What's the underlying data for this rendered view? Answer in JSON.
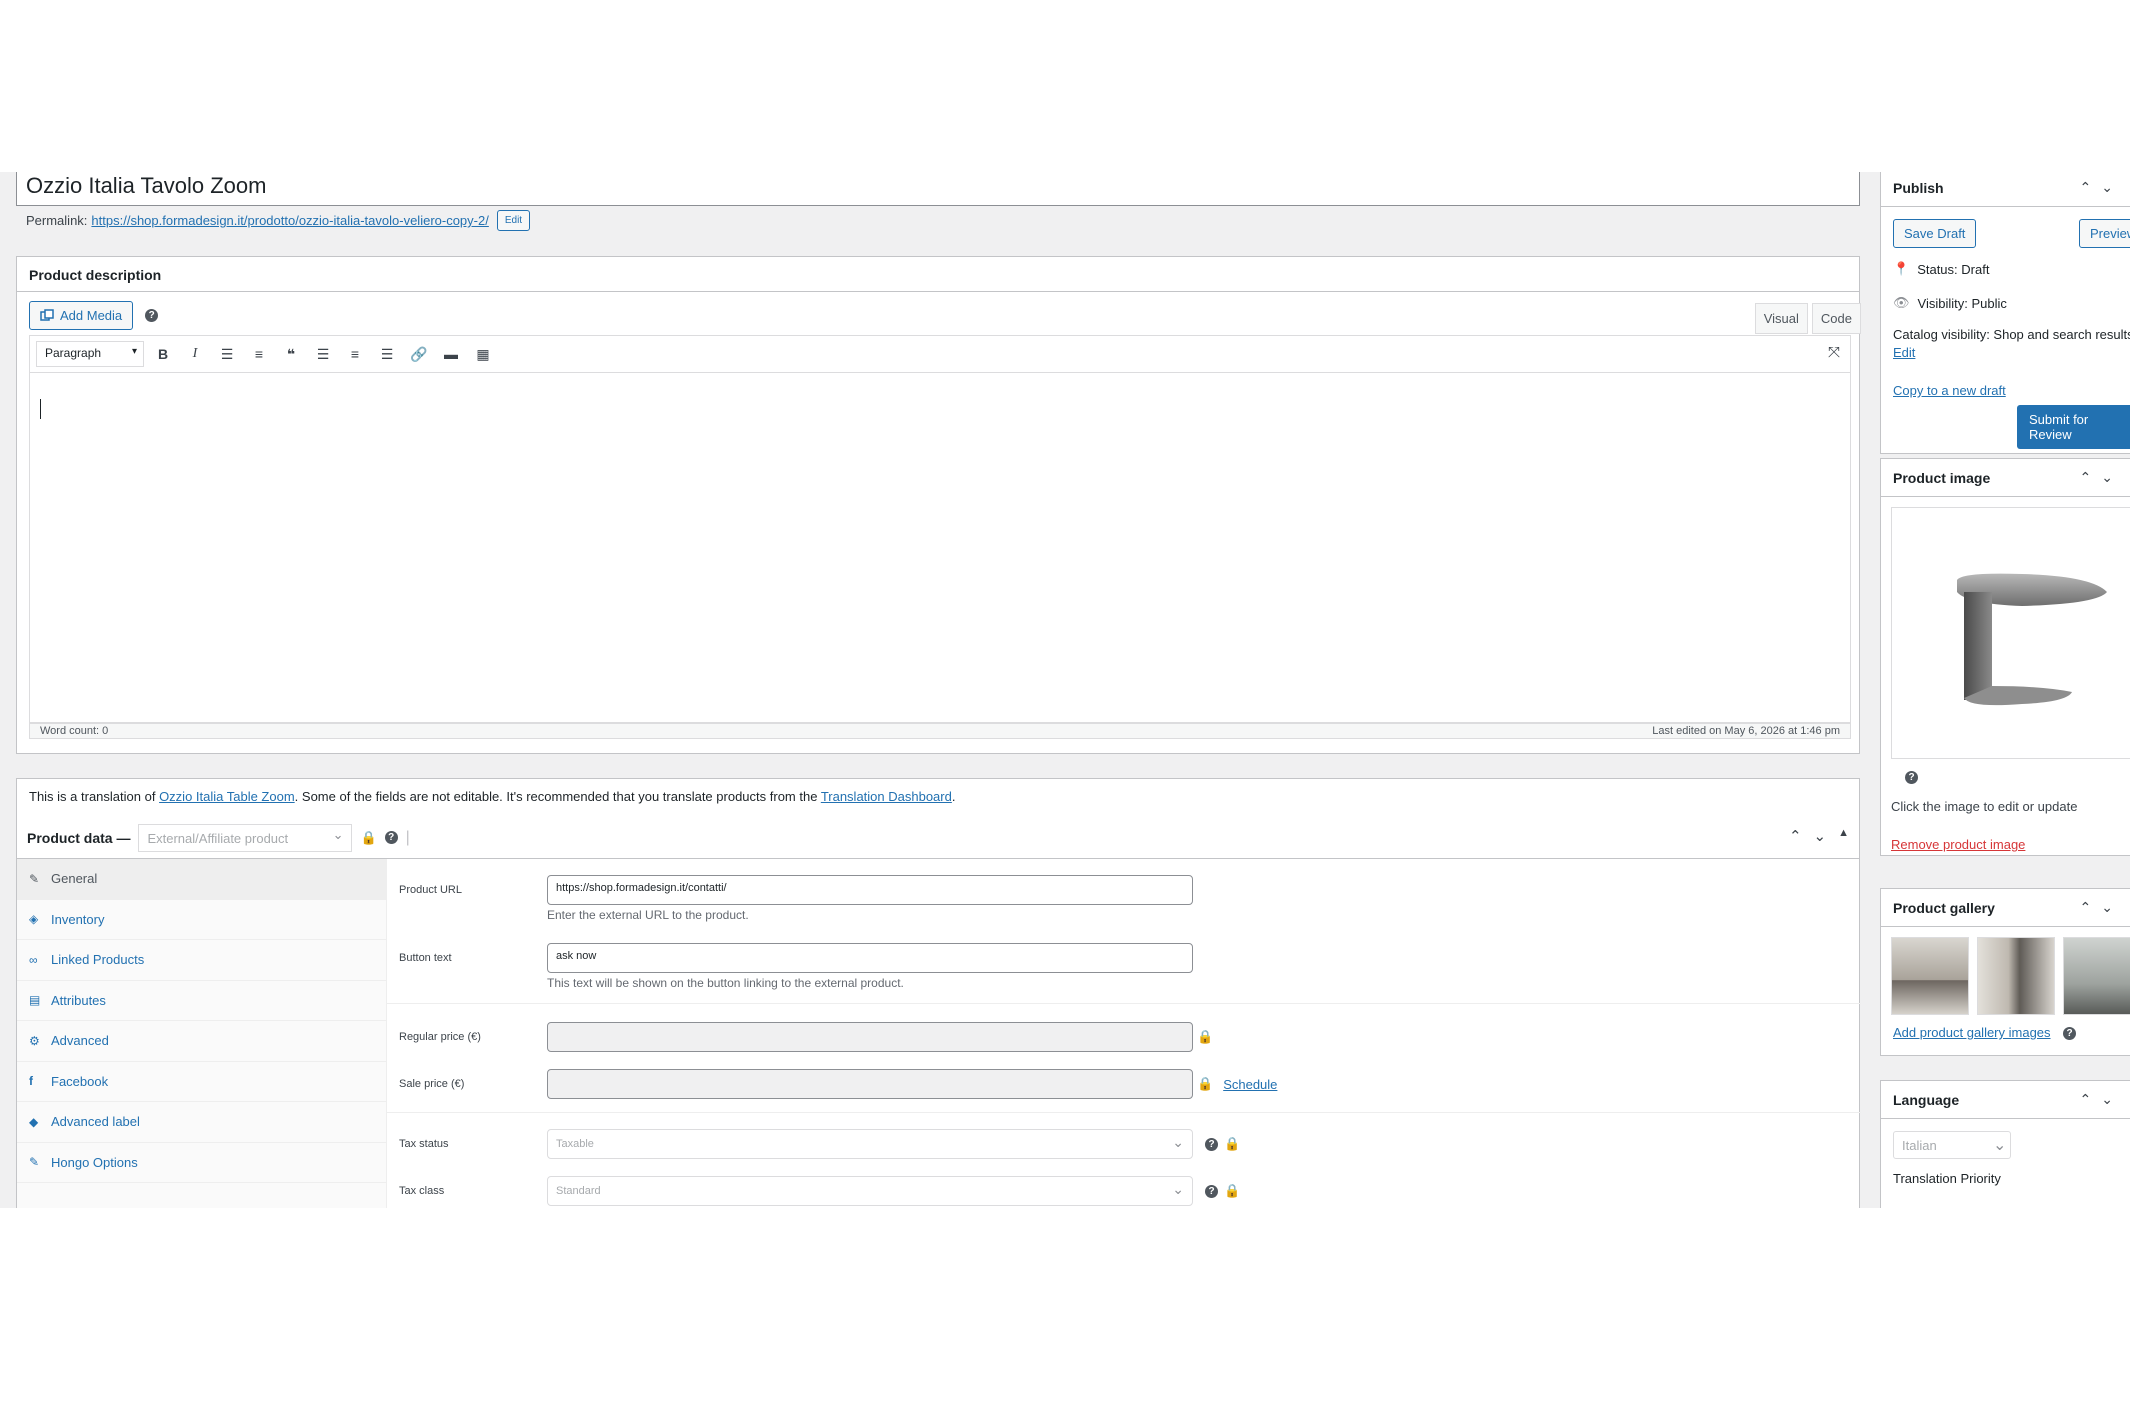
{
  "title": "Ozzio Italia Tavolo Zoom",
  "permalink": {
    "label": "Permalink:",
    "url": "https://shop.formadesign.it/prodotto/ozzio-italia-tavolo-veliero-copy-2/",
    "edit_label": "Edit"
  },
  "description": {
    "header": "Product description",
    "add_media": "Add Media",
    "tab_visual": "Visual",
    "tab_code": "Code",
    "format": "Paragraph",
    "word_count": "Word count: 0",
    "last_edited": "Last edited on May 6, 2026 at 1:46 pm"
  },
  "translation_note": {
    "prefix": "This is a translation of ",
    "link1": "Ozzio Italia Table Zoom",
    "middle": ". Some of the fields are not editable. It's recommended that you translate products from the ",
    "link2": "Translation Dashboard",
    "suffix": "."
  },
  "product_data": {
    "title": "Product data —",
    "type": "External/Affiliate product",
    "tabs": [
      {
        "label": "General",
        "icon": "wrench-icon"
      },
      {
        "label": "Inventory",
        "icon": "tag-icon"
      },
      {
        "label": "Linked Products",
        "icon": "link-icon"
      },
      {
        "label": "Attributes",
        "icon": "table-icon"
      },
      {
        "label": "Advanced",
        "icon": "gear-icon"
      },
      {
        "label": "Facebook",
        "icon": "facebook-icon"
      },
      {
        "label": "Advanced label",
        "icon": "tag-icon"
      },
      {
        "label": "Hongo Options",
        "icon": "wrench-icon"
      }
    ],
    "fields": {
      "product_url_label": "Product URL",
      "product_url_value": "https://shop.formadesign.it/contatti/",
      "product_url_desc": "Enter the external URL to the product.",
      "button_text_label": "Button text",
      "button_text_value": "ask now",
      "button_text_desc": "This text will be shown on the button linking to the external product.",
      "regular_price_label": "Regular price (€)",
      "sale_price_label": "Sale price (€)",
      "schedule_label": "Schedule",
      "tax_status_label": "Tax status",
      "tax_status_value": "Taxable",
      "tax_class_label": "Tax class",
      "tax_class_value": "Standard"
    }
  },
  "publish": {
    "title": "Publish",
    "save_draft": "Save Draft",
    "preview": "Preview",
    "status": "Status: Draft",
    "visibility": "Visibility: Public",
    "catalog_visibility": "Catalog visibility: Shop and search results",
    "edit": "Edit",
    "copy_draft": "Copy to a new draft",
    "submit": "Submit for Review"
  },
  "product_image": {
    "title": "Product image",
    "hint": "Click the image to edit or update",
    "remove": "Remove product image"
  },
  "gallery": {
    "title": "Product gallery",
    "add": "Add product gallery images"
  },
  "language": {
    "title": "Language",
    "value": "Italian",
    "priority": "Translation Priority"
  },
  "colors": {
    "accent": "#2271b1",
    "background": "#f0f0f1",
    "lock": "#dba617",
    "danger": "#d63638"
  }
}
